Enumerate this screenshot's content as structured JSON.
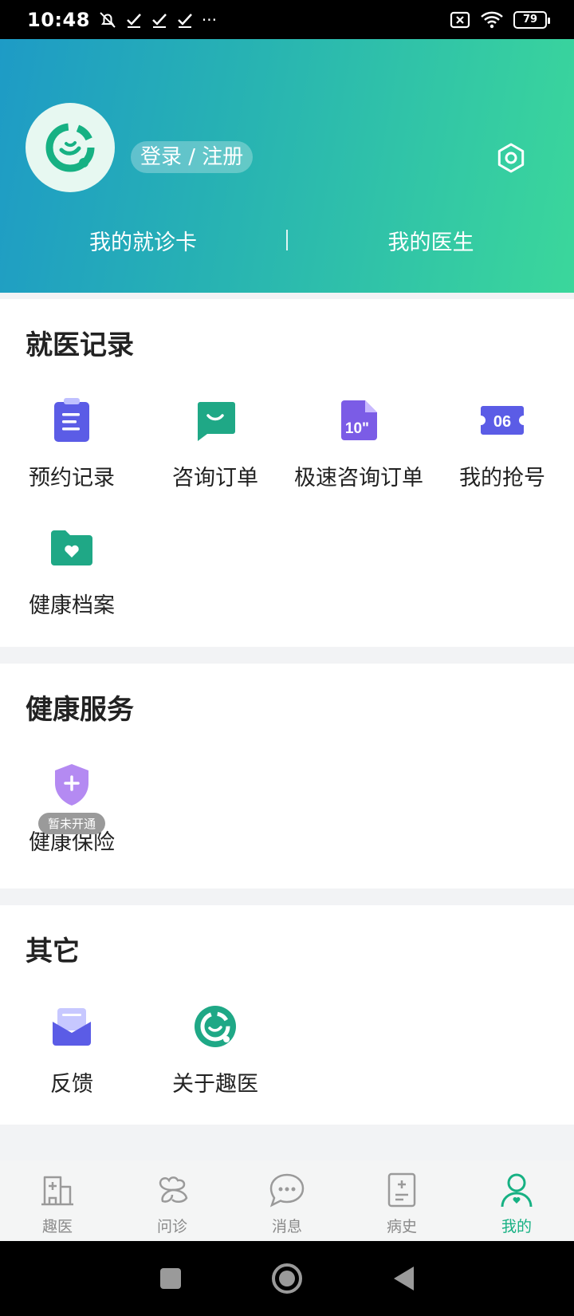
{
  "status_bar": {
    "time": "10:48",
    "more": "···",
    "battery": "79"
  },
  "header": {
    "login_label": "登录 / 注册",
    "tabs": [
      {
        "label": "我的就诊卡"
      },
      {
        "label": "我的医生"
      }
    ],
    "gradient": [
      "#1e9bc6",
      "#3bd79b"
    ]
  },
  "records": {
    "title": "就医记录",
    "items": [
      {
        "label": "预约记录",
        "icon": "clipboard-icon"
      },
      {
        "label": "咨询订单",
        "icon": "chat-icon"
      },
      {
        "label": "极速咨询订单",
        "icon": "document-10-icon",
        "icon_text": "10\""
      },
      {
        "label": "我的抢号",
        "icon": "ticket-icon",
        "icon_text": "06"
      },
      {
        "label": "健康档案",
        "icon": "folder-heart-icon"
      }
    ]
  },
  "services": {
    "title": "健康服务",
    "items": [
      {
        "label": "健康保险",
        "icon": "shield-plus-icon",
        "badge": "暂未开通"
      }
    ]
  },
  "others": {
    "title": "其它",
    "items": [
      {
        "label": "反馈",
        "icon": "mail-icon"
      },
      {
        "label": "关于趣医",
        "icon": "app-logo-icon"
      }
    ]
  },
  "bottom_nav": {
    "items": [
      {
        "label": "趣医",
        "icon": "hospital-icon"
      },
      {
        "label": "问诊",
        "icon": "clover-icon"
      },
      {
        "label": "消息",
        "icon": "message-icon"
      },
      {
        "label": "病史",
        "icon": "record-icon"
      },
      {
        "label": "我的",
        "icon": "person-icon",
        "active": true
      }
    ],
    "active_color": "#16b183"
  },
  "colors": {
    "accent_green": "#16b183",
    "purple": "#5b5ce6"
  }
}
